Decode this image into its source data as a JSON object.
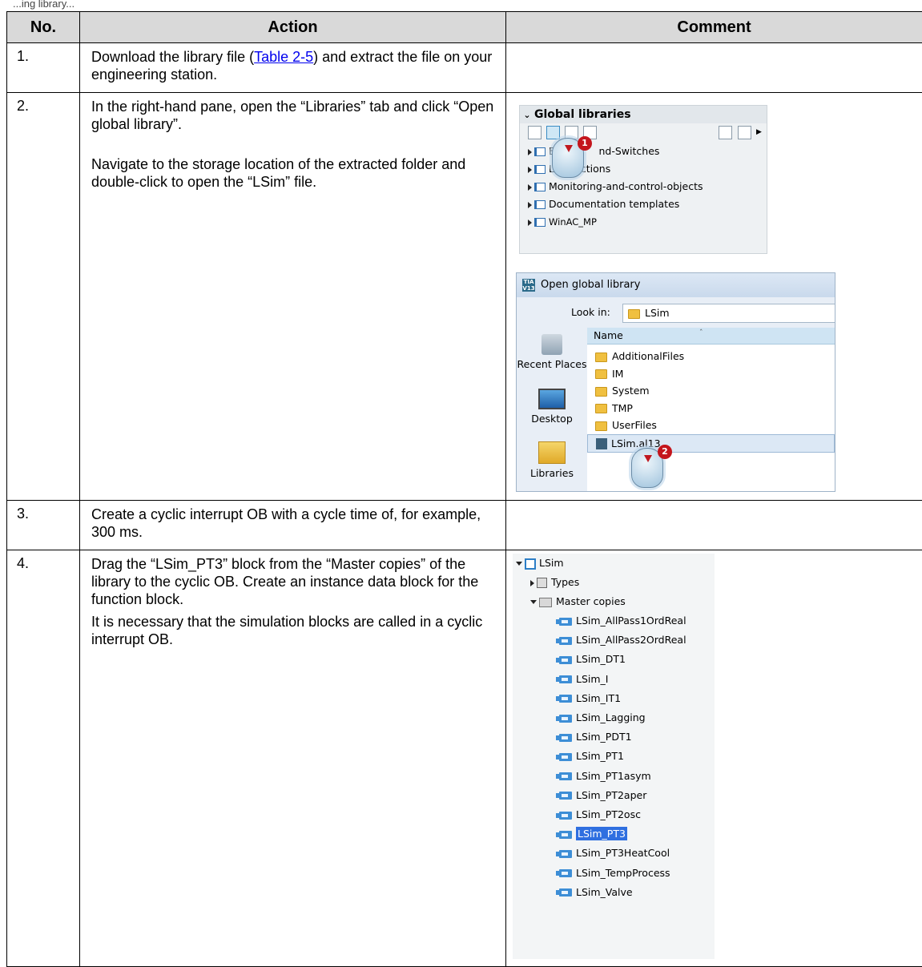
{
  "header_text": "...ing library...",
  "table": {
    "headers": {
      "no": "No.",
      "action": "Action",
      "comment": "Comment"
    },
    "rows": [
      {
        "no": "1.",
        "action_pre": "Download the library file (",
        "action_link": "Table 2-5",
        "action_post": ") and extract the file on your engineering station."
      },
      {
        "no": "2.",
        "action_p1": "In the right-hand pane, open the “Libraries” tab and click “Open global library”.",
        "action_p2": "Navigate to the storage location of the extracted folder and double-click to open the “LSim” file."
      },
      {
        "no": "3.",
        "action": "Create a cyclic interrupt OB with a cycle time of, for example, 300 ms."
      },
      {
        "no": "4.",
        "action_p1": "Drag the “LSim_PT3” block from the “Master copies” of the library to the cyclic OB. Create an instance data block for the function block.",
        "action_p2": "It is necessary that the simulation blocks are called in a cyclic interrupt OB."
      }
    ]
  },
  "global_libraries": {
    "title": "Global libraries",
    "items": [
      "Bu",
      "nd-Switches",
      "Lo",
      "ictions",
      "Monitoring-and-control-objects",
      "Documentation templates",
      "WinAC_MP"
    ],
    "badge": "1"
  },
  "open_dialog": {
    "title": "Open global library",
    "look_in_label": "Look in:",
    "look_in_value": "LSim",
    "column_name": "Name",
    "places": [
      "Recent Places",
      "Desktop",
      "Libraries"
    ],
    "files": [
      "AdditionalFiles",
      "IM",
      "System",
      "TMP",
      "UserFiles",
      "LSim.al13"
    ],
    "badge": "2"
  },
  "tree": {
    "root": "LSim",
    "types": "Types",
    "master_copies": "Master copies",
    "blocks": [
      "LSim_AllPass1OrdReal",
      "LSim_AllPass2OrdReal",
      "LSim_DT1",
      "LSim_I",
      "LSim_IT1",
      "LSim_Lagging",
      "LSim_PDT1",
      "LSim_PT1",
      "LSim_PT1asym",
      "LSim_PT2aper",
      "LSim_PT2osc",
      "LSim_PT3",
      "LSim_PT3HeatCool",
      "LSim_TempProcess",
      "LSim_Valve"
    ],
    "selected": "LSim_PT3"
  }
}
